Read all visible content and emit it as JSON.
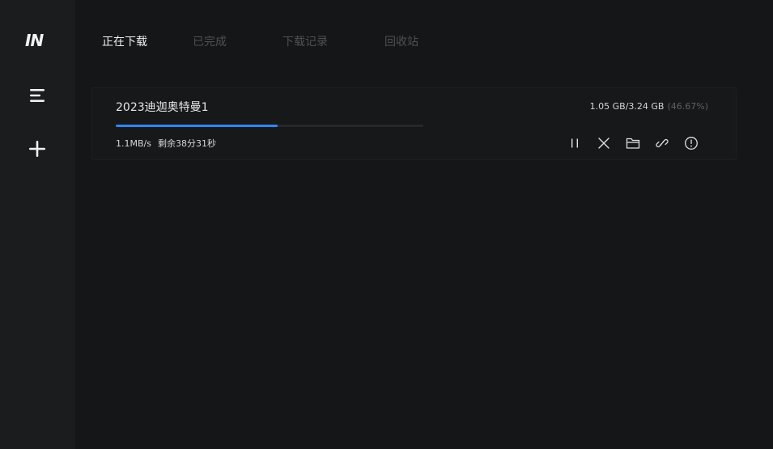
{
  "app": {
    "logo_text": "IN"
  },
  "sidebar": {
    "items": [
      {
        "icon": "menu-icon"
      },
      {
        "icon": "plus-icon"
      }
    ]
  },
  "tabs": [
    {
      "label": "正在下载",
      "active": true
    },
    {
      "label": "已完成",
      "active": false
    },
    {
      "label": "下载记录",
      "active": false
    },
    {
      "label": "回收站",
      "active": false
    }
  ],
  "downloads": [
    {
      "name": "2023迪迦奥特曼1",
      "speed": "1.1MB/s",
      "remaining": "剩余38分31秒",
      "size": "1.05 GB/3.24 GB",
      "percent_text": "(46.67%)",
      "progress": 0.5263,
      "actions": [
        "pause-icon",
        "close-icon",
        "folder-icon",
        "link-icon",
        "info-icon"
      ]
    }
  ],
  "colors": {
    "background": "#151618",
    "sidebar": "#1b1c1e",
    "accent": "#2f86f6",
    "inactive_tab": "#4e5055"
  }
}
